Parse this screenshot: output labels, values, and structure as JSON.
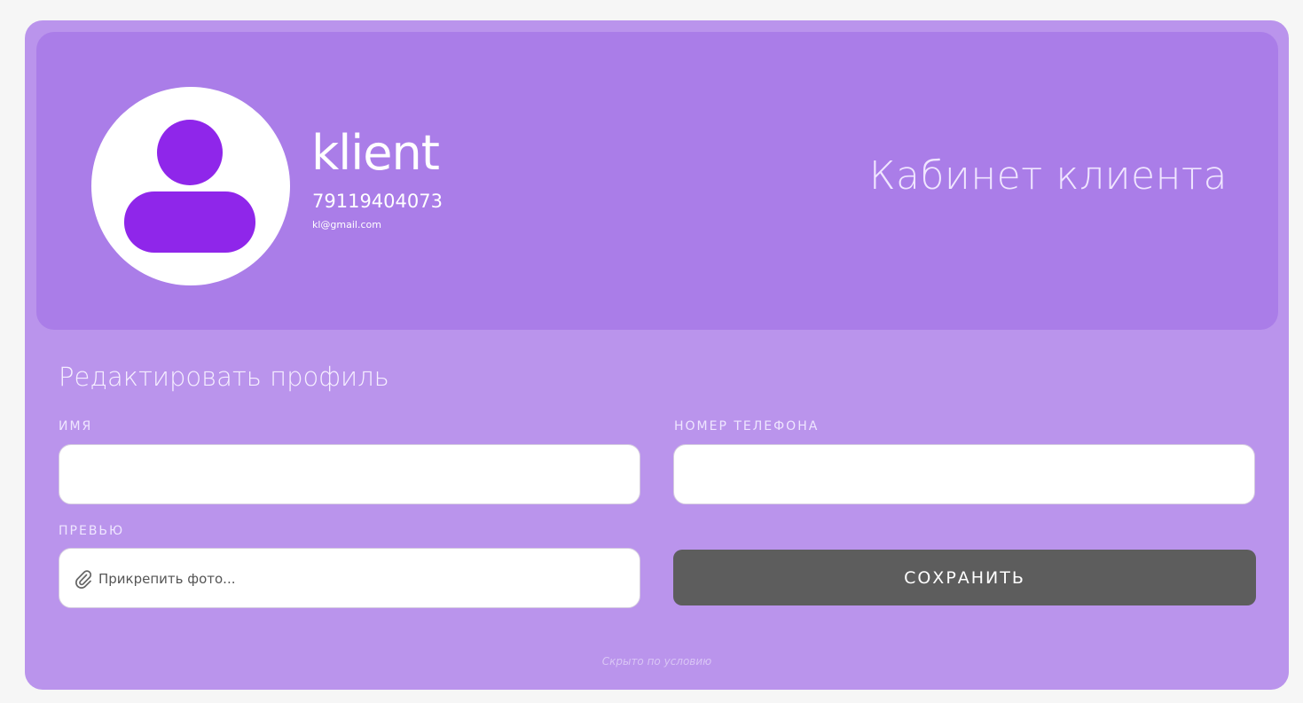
{
  "profile": {
    "name": "klient",
    "phone": "79119404073",
    "email": "kl@gmail.com",
    "avatar_icon": "user-avatar-icon"
  },
  "header": {
    "cabinet_title": "Кабинет клиента"
  },
  "edit": {
    "title": "Редактировать профиль",
    "name_label": "ИМЯ",
    "name_value": "",
    "phone_label": "НОМЕР ТЕЛЕФОНА",
    "phone_value": "",
    "preview_label": "ПРЕВЬЮ",
    "attach_text": "Прикрепить фото...",
    "attach_icon": "paperclip-icon",
    "save_label": "СОХРАНИТЬ"
  },
  "footer": {
    "note": "Скрыто по условию"
  },
  "colors": {
    "page_bg": "#f6f6f6",
    "card_bg": "#ba94ec",
    "hero_bg": "#aa7de8",
    "avatar_accent": "#8f26ea",
    "save_button": "#5d5d5d"
  }
}
